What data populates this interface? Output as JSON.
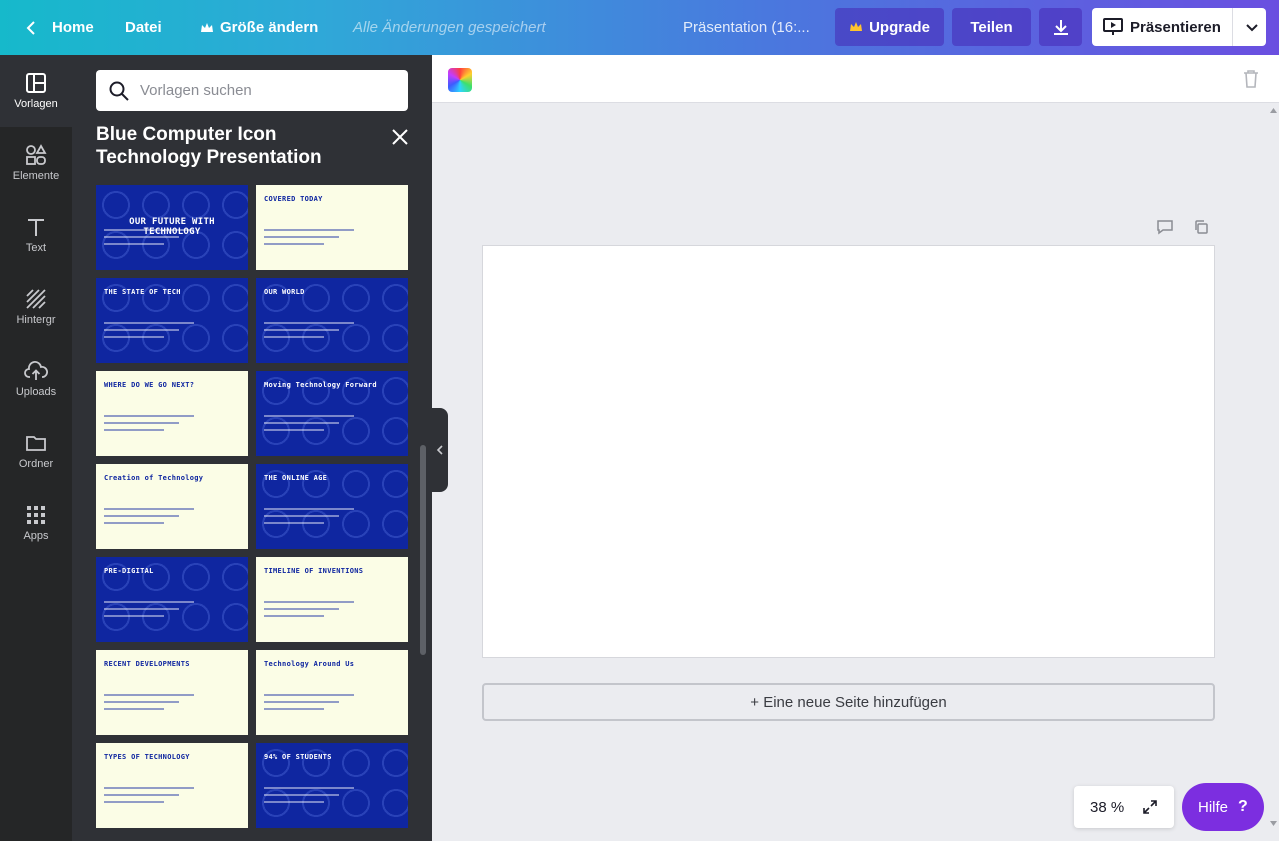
{
  "topbar": {
    "home": "Home",
    "file": "Datei",
    "resize": "Größe ändern",
    "saved": "Alle Änderungen gespeichert",
    "doc_title": "Präsentation (16:...",
    "upgrade": "Upgrade",
    "share": "Teilen",
    "present": "Präsentieren"
  },
  "rail": [
    {
      "label": "Vorlagen",
      "icon": "templates-icon"
    },
    {
      "label": "Elemente",
      "icon": "elements-icon"
    },
    {
      "label": "Text",
      "icon": "text-icon"
    },
    {
      "label": "Hintergr",
      "icon": "background-icon"
    },
    {
      "label": "Uploads",
      "icon": "upload-icon"
    },
    {
      "label": "Ordner",
      "icon": "folder-icon"
    },
    {
      "label": "Apps",
      "icon": "apps-icon"
    }
  ],
  "panel": {
    "search_placeholder": "Vorlagen suchen",
    "title": "Blue Computer Icon Technology Presentation",
    "thumbs": [
      {
        "style": "blue",
        "heading": "OUR FUTURE WITH TECHNOLOGY"
      },
      {
        "style": "cream",
        "heading": "COVERED TODAY"
      },
      {
        "style": "blue",
        "heading": "THE STATE OF TECH"
      },
      {
        "style": "blue",
        "heading": "OUR WORLD"
      },
      {
        "style": "cream",
        "heading": "WHERE DO WE GO NEXT?"
      },
      {
        "style": "blue",
        "heading": "Moving Technology Forward"
      },
      {
        "style": "cream",
        "heading": "Creation of Technology"
      },
      {
        "style": "blue",
        "heading": "THE ONLINE AGE"
      },
      {
        "style": "blue",
        "heading": "PRE-DIGITAL"
      },
      {
        "style": "cream",
        "heading": "TIMELINE OF INVENTIONS"
      },
      {
        "style": "cream",
        "heading": "RECENT DEVELOPMENTS"
      },
      {
        "style": "cream",
        "heading": "Technology Around Us"
      },
      {
        "style": "cream",
        "heading": "TYPES OF TECHNOLOGY"
      },
      {
        "style": "blue",
        "heading": "94% OF STUDENTS"
      }
    ]
  },
  "canvas": {
    "add_page": "+ Eine neue Seite hinzufügen",
    "zoom": "38 %",
    "help": "Hilfe"
  },
  "colors": {
    "brand_blue": "#0f26a0",
    "cream": "#fbfde6",
    "help_purple": "#7c2ee0"
  }
}
